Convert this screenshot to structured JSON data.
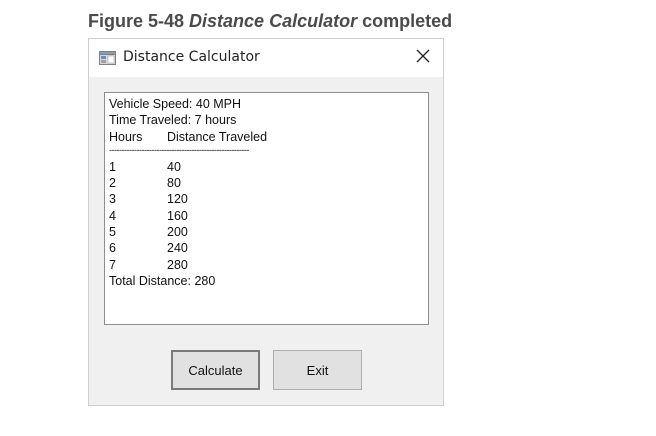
{
  "caption": {
    "prefix": "Figure 5-48 ",
    "italic": "Distance Calculator",
    "suffix": " completed"
  },
  "window": {
    "title": "Distance Calculator",
    "close_glyph": "✕"
  },
  "output": {
    "speed_line": "Vehicle Speed: 40 MPH",
    "time_line": "Time Traveled: 7 hours",
    "header": {
      "hours": "Hours",
      "distance": "Distance Traveled"
    },
    "separator": "--------------------------------------------------------",
    "rows": [
      {
        "hour": "1",
        "distance": "40"
      },
      {
        "hour": "2",
        "distance": "80"
      },
      {
        "hour": "3",
        "distance": "120"
      },
      {
        "hour": "4",
        "distance": "160"
      },
      {
        "hour": "5",
        "distance": "200"
      },
      {
        "hour": "6",
        "distance": "240"
      },
      {
        "hour": "7",
        "distance": "280"
      }
    ],
    "total_line": "Total Distance: 280"
  },
  "buttons": {
    "calculate": "Calculate",
    "exit": "Exit"
  }
}
